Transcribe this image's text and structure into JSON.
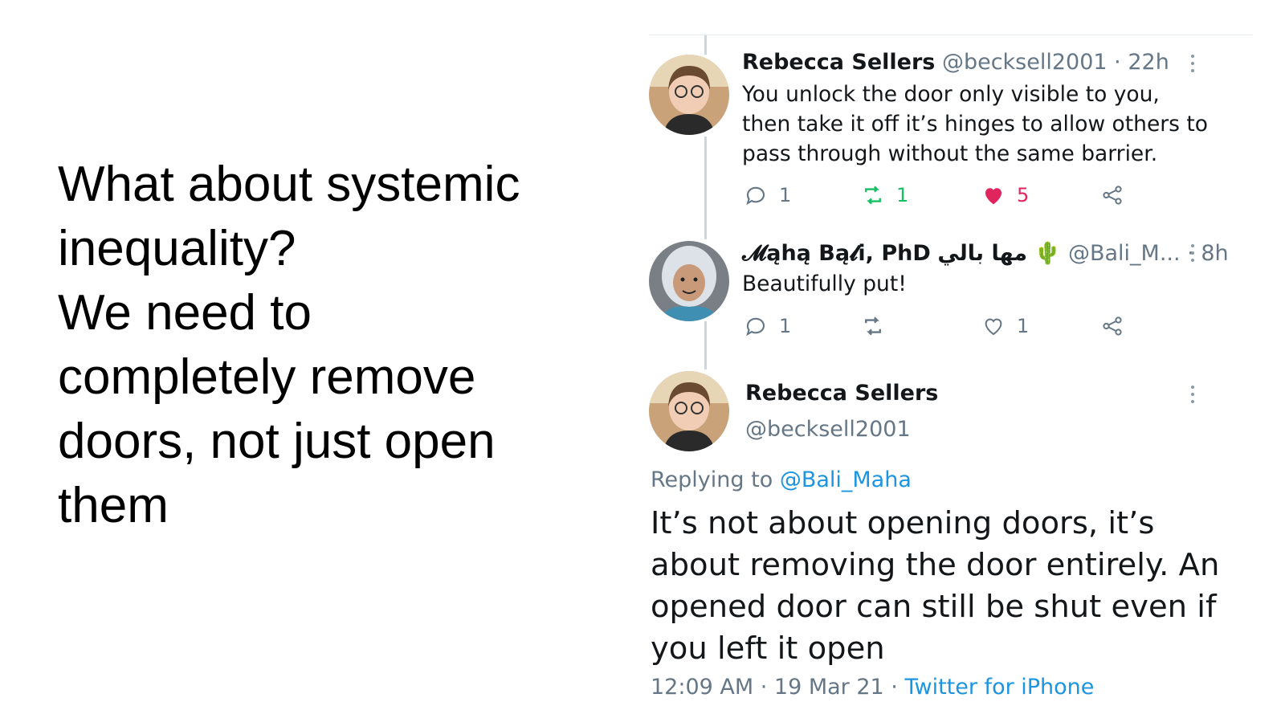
{
  "slide": {
    "lines": [
      "What about systemic",
      "inequality?",
      "We need to",
      "completely remove",
      "doors, not just open",
      "them"
    ]
  },
  "tweets": [
    {
      "name": "Rebecca Sellers",
      "handle": "@becksell2001",
      "dot": "·",
      "time": "22h",
      "body": "You unlock the door only visible to you, then take it off it’s hinges to allow others to pass through without the same barrier.",
      "replies": "1",
      "retweets": "1",
      "likes": "5"
    },
    {
      "name": "𝓜ąhą Bą𝓵i, PhD",
      "arabic": "مها بالي",
      "emoji": "🌵",
      "handle": "@Bali_M...",
      "dot": "·",
      "time": "8h",
      "body": "Beautifully put!",
      "replies": "1",
      "retweets": "",
      "likes": "1"
    }
  ],
  "detail": {
    "name": "Rebecca Sellers",
    "handle": "@becksell2001",
    "replying_prefix": "Replying to ",
    "replying_handle": "@Bali_Maha",
    "body": "It’s not about opening doors, it’s about removing the door entirely. An opened door can still be shut even if you left it open",
    "timestamp": "12:09 AM · 19 Mar 21 · ",
    "source": "Twitter for iPhone"
  },
  "colors": {
    "accent": "#1b95e0",
    "like": "#e0245e",
    "retweet": "#17bf63",
    "muted": "#657786"
  }
}
